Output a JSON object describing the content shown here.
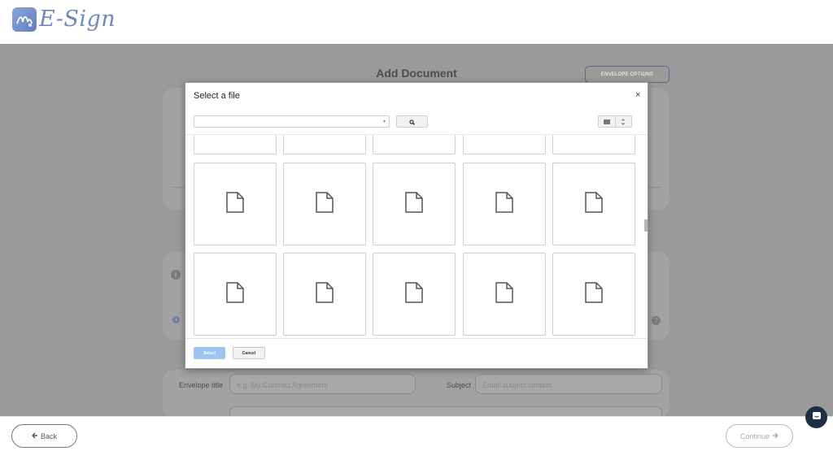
{
  "app": {
    "logo_text": "E-Sign",
    "colors": {
      "brand": "#6f86c0",
      "primary_button": "#9fc4ef",
      "overlay": "#9a9a9a"
    }
  },
  "page": {
    "title": "Add Document",
    "envelope_options_label": "ENVELOPE OPTIONS",
    "form": {
      "envelope_title_label": "Envelope title",
      "envelope_title_placeholder": "e.g. My Contract Agreement",
      "subject_label": "Subject",
      "subject_placeholder": "Email subject content"
    }
  },
  "footer": {
    "back_label": "Back",
    "continue_label": "Continue"
  },
  "modal": {
    "title": "Select a file",
    "close_glyph": "×",
    "file_select_value": "",
    "search_icon": "search-icon",
    "view_icons": [
      "list-view-icon",
      "sort-icon"
    ],
    "file_tiles": [
      {
        "icon": "file-icon"
      },
      {
        "icon": "file-icon"
      },
      {
        "icon": "file-icon"
      },
      {
        "icon": "file-icon"
      },
      {
        "icon": "file-icon"
      },
      {
        "icon": "file-icon"
      },
      {
        "icon": "file-icon"
      },
      {
        "icon": "file-icon"
      },
      {
        "icon": "file-icon"
      },
      {
        "icon": "file-icon"
      },
      {
        "icon": "file-icon"
      },
      {
        "icon": "file-icon"
      },
      {
        "icon": "file-icon"
      },
      {
        "icon": "file-icon"
      },
      {
        "icon": "file-icon"
      }
    ],
    "select_label": "Select",
    "cancel_label": "Cancel"
  }
}
